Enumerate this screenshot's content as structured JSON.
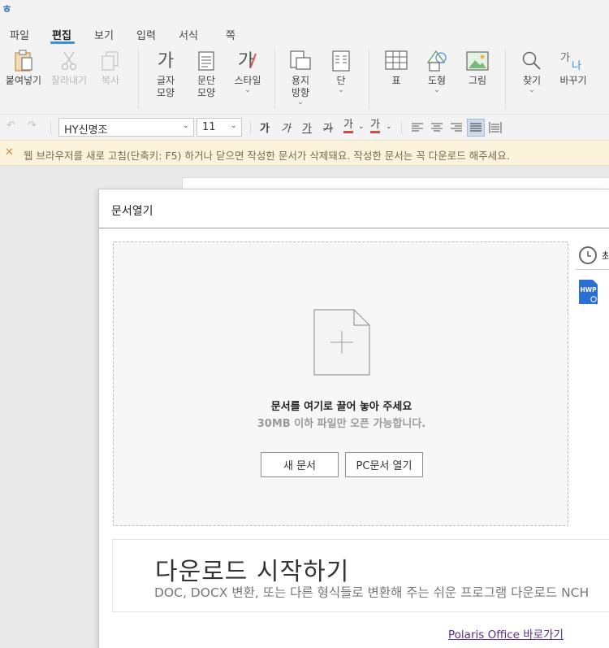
{
  "app": {
    "logo_glyph": "ㅎ",
    "accent_color": "#3b8fd9"
  },
  "menu": {
    "items": [
      {
        "label": "파일"
      },
      {
        "label": "편집"
      },
      {
        "label": "보기"
      },
      {
        "label": "입력"
      },
      {
        "label": "서식"
      },
      {
        "label": "쪽"
      }
    ],
    "active_label": "편집"
  },
  "ribbon": {
    "paste": "붙여넣기",
    "cut": "잘라내기",
    "copy": "복사",
    "char_shape_glyph": "가",
    "char_shape": [
      "글자",
      "모양"
    ],
    "para_shape": [
      "문단",
      "모양"
    ],
    "style_glyph": "가",
    "style": "스타일",
    "paper": [
      "용지",
      "방향"
    ],
    "column": "단",
    "table": "표",
    "shape": "도형",
    "picture": "그림",
    "find": "찾기",
    "replace": "바꾸기",
    "replace_glyph_a": "가",
    "replace_glyph_b": "나"
  },
  "format": {
    "font_name": "HY신명조",
    "font_size": "11",
    "bold_glyph": "가",
    "italic_glyph": "가",
    "underline_glyph": "가",
    "strike_glyph": "가",
    "color_glyph": "가",
    "highlight_glyph": "가",
    "text_color": "#d44a4a"
  },
  "warning": {
    "text": "웹 브라우저를 새로 고침(단축키: F5) 하거나 닫으면 작성한 문서가 삭제돼요. 작성한 문서는 꼭 다운로드 해주세요."
  },
  "dialog": {
    "title": "문서열기",
    "drop_title": "문서를 여기로 끌어 놓아 주세요",
    "drop_sub": "30MB 이하 파일만 오픈 가능합니다.",
    "new_doc": "새 문서",
    "open_pc": "PC문서 열기",
    "recent_label": "최",
    "hwp_label": "HWP",
    "ad_title": "다운로드 시작하기",
    "ad_desc": "DOC, DOCX 변환, 또는 다른 형식들로 변환해 주는 쉬운 프로그램 다운로드 NCH",
    "polaris_link": "Polaris Office 바로가기"
  }
}
